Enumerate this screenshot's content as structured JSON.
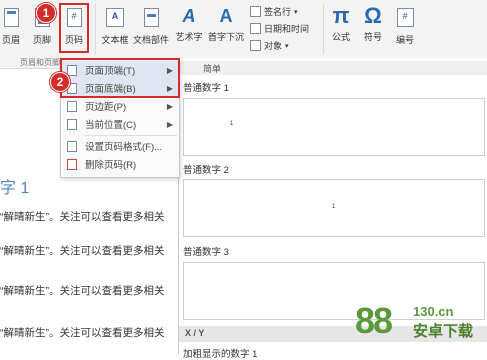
{
  "ribbon": {
    "buttons": [
      {
        "id": "header",
        "label": "页眉"
      },
      {
        "id": "footer",
        "label": "页脚"
      },
      {
        "id": "page_number",
        "label": "页码"
      },
      {
        "id": "textbox",
        "label": "文本框"
      },
      {
        "id": "quick_parts",
        "label": "文档部件"
      },
      {
        "id": "wordart",
        "label": "艺术字"
      },
      {
        "id": "dropcap",
        "label": "首字下沉"
      },
      {
        "id": "equation",
        "label": "公式"
      },
      {
        "id": "symbol",
        "label": "符号"
      },
      {
        "id": "numbering",
        "label": "编号"
      }
    ],
    "small_items": [
      {
        "id": "signature",
        "label": "签名行"
      },
      {
        "id": "datetime",
        "label": "日期和时间"
      },
      {
        "id": "object",
        "label": "对象"
      }
    ],
    "group_label": "页眉和页脚",
    "symbols": {
      "pi": "π",
      "omega": "Ω",
      "hash": "#"
    }
  },
  "menu": {
    "items": [
      {
        "label": "页面顶端(T)",
        "submenu": true,
        "highlighted": true,
        "disabled": false
      },
      {
        "label": "页面底端(B)",
        "submenu": true,
        "highlighted": true,
        "disabled": false
      },
      {
        "label": "页边距(P)",
        "submenu": true,
        "highlighted": false,
        "disabled": false
      },
      {
        "label": "当前位置(C)",
        "submenu": true,
        "highlighted": false,
        "disabled": false
      },
      {
        "label": "设置页码格式(F)...",
        "submenu": false,
        "highlighted": false,
        "disabled": false
      },
      {
        "label": "删除页码(R)",
        "submenu": false,
        "highlighted": false,
        "disabled": false
      }
    ]
  },
  "gallery": {
    "section_simple": "简单",
    "items": [
      {
        "label": "普通数字 1",
        "page": "1"
      },
      {
        "label": "普通数字 2",
        "page": "1"
      },
      {
        "label": "普通数字 3",
        "page": ""
      }
    ],
    "section_xy": "X / Y",
    "bottom_label": "加粗显示的数字 1"
  },
  "document": {
    "heading": "字 1",
    "lines": [
      "“解晴新生”。关注可以查看更多相关",
      "“解晴新生”。关注可以查看更多相关",
      "“解晴新生”。关注可以查看更多相关",
      "“解晴新生”。关注可以查看更多相关"
    ]
  },
  "callouts": {
    "one": "1",
    "two": "2"
  },
  "watermark": {
    "number": "88",
    "domain": "130.cn",
    "text": "安卓下载"
  },
  "colors": {
    "accent": "#d62b2b",
    "heading": "#4a86c8",
    "highlight": "#dfe6f1"
  }
}
